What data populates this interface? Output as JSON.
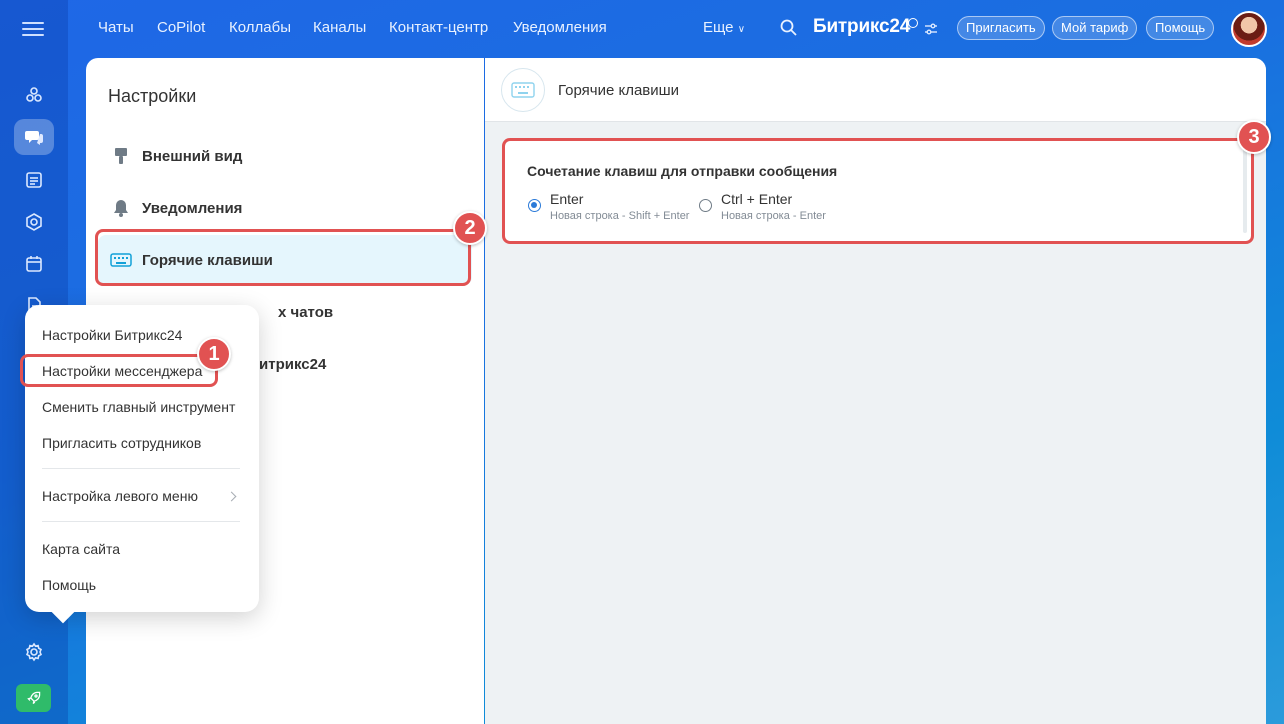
{
  "top_nav": {
    "items": [
      "Чаты",
      "CoPilot",
      "Коллабы",
      "Каналы",
      "Контакт-центр",
      "Уведомления"
    ],
    "more": "Еще",
    "brand": "Битрикс",
    "brand_num": "24",
    "invite": "Пригласить",
    "tariff": "Мой тариф",
    "help": "Помощь"
  },
  "settings": {
    "title": "Настройки",
    "items": [
      "Внешний вид",
      "Уведомления",
      "Горячие клавиши"
    ],
    "partial_chats": "х чатов",
    "partial_bitrix": "итрикс24"
  },
  "content": {
    "title": "Горячие клавиши",
    "card_title": "Сочетание клавиш для отправки сообщения",
    "options": [
      {
        "label": "Enter",
        "sub": "Новая строка - Shift + Enter",
        "checked": true
      },
      {
        "label": "Ctrl + Enter",
        "sub": "Новая строка - Enter",
        "checked": false
      }
    ]
  },
  "dropdown": {
    "items": [
      "Настройки Битрикс24",
      "Настройки мессенджера",
      "Сменить главный инструмент",
      "Пригласить сотрудников",
      "Настройка левого меню",
      "Карта сайта",
      "Помощь"
    ]
  },
  "badges": [
    "1",
    "2",
    "3"
  ],
  "colors": {
    "highlight": "#e15252",
    "accent": "#2b7ad8",
    "active_bg": "#e5f6fd",
    "launch": "#2fbb6a"
  },
  "icons": [
    "menu-icon",
    "projects-icon",
    "chat-icon",
    "feed-icon",
    "hex-icon",
    "calendar-icon",
    "document-icon",
    "gear-icon",
    "rocket-icon",
    "search-icon",
    "keyboard-icon",
    "brush-icon",
    "bell-icon"
  ]
}
